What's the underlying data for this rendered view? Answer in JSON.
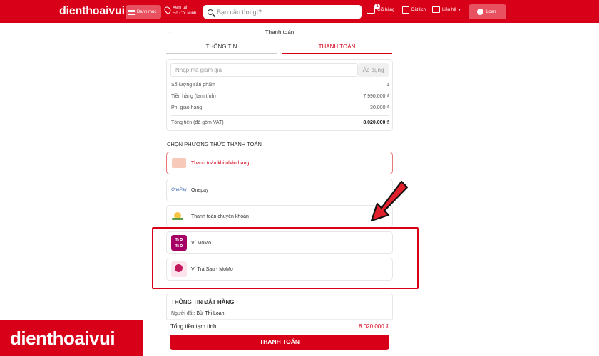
{
  "header": {
    "logo": "dienthoaivui",
    "menu_label": "Danh mục",
    "location_line1": "Xem tại",
    "location_line2": "Hồ Chí Minh",
    "search_placeholder": "Bạn cần tìm gì?",
    "cart_label": "Giỏ hàng",
    "cart_count": "1",
    "booking_label": "Đặt lịch",
    "contact_label": "Liên hệ",
    "user_label": "Loan"
  },
  "page": {
    "title": "Thanh toán",
    "tabs": [
      {
        "label": "THÔNG TIN"
      },
      {
        "label": "THANH TOÁN"
      }
    ]
  },
  "summary": {
    "coupon_placeholder": "Nhập mã giảm giá",
    "apply_label": "Áp dụng",
    "rows": [
      {
        "label": "Số lượng sản phẩm",
        "value": "1"
      },
      {
        "label": "Tiền hàng (tạm tính)",
        "value": "7.990.000 ₫"
      },
      {
        "label": "Phí giao hàng",
        "value": "30.000 ₫"
      }
    ],
    "total_label": "Tổng tiền (đã gồm VAT)",
    "total_value": "8.020.000 ₫"
  },
  "payment": {
    "section_title": "CHỌN PHƯƠNG THỨC THANH TOÁN",
    "methods": [
      {
        "label": "Thanh toán khi nhận hàng",
        "icon": "cod-icon",
        "selected": true
      },
      {
        "label": "Onepay",
        "icon": "onepay-icon",
        "icon_text": "OnePay",
        "selected": false
      },
      {
        "label": "Thanh toán chuyển khoản",
        "icon": "bank-transfer-icon",
        "selected": false
      },
      {
        "label": "Ví MoMo",
        "icon": "momo-icon",
        "icon_text": "mo mo",
        "selected": false
      },
      {
        "label": "Ví Trả Sau - MoMo",
        "icon": "momo-paylater-icon",
        "selected": false
      }
    ]
  },
  "order": {
    "section_title": "THÔNG TIN ĐẶT HÀNG",
    "buyer_label": "Người đặt:",
    "buyer_name": "Bùi Thị Loan"
  },
  "footer": {
    "total_label": "Tổng tiền tạm tính:",
    "total_value": "8.020.000 ₫",
    "pay_button": "THANH TOÁN"
  },
  "watermark": "dienthoaivui",
  "colors": {
    "brand": "#d70018",
    "highlight": "#d70018"
  }
}
